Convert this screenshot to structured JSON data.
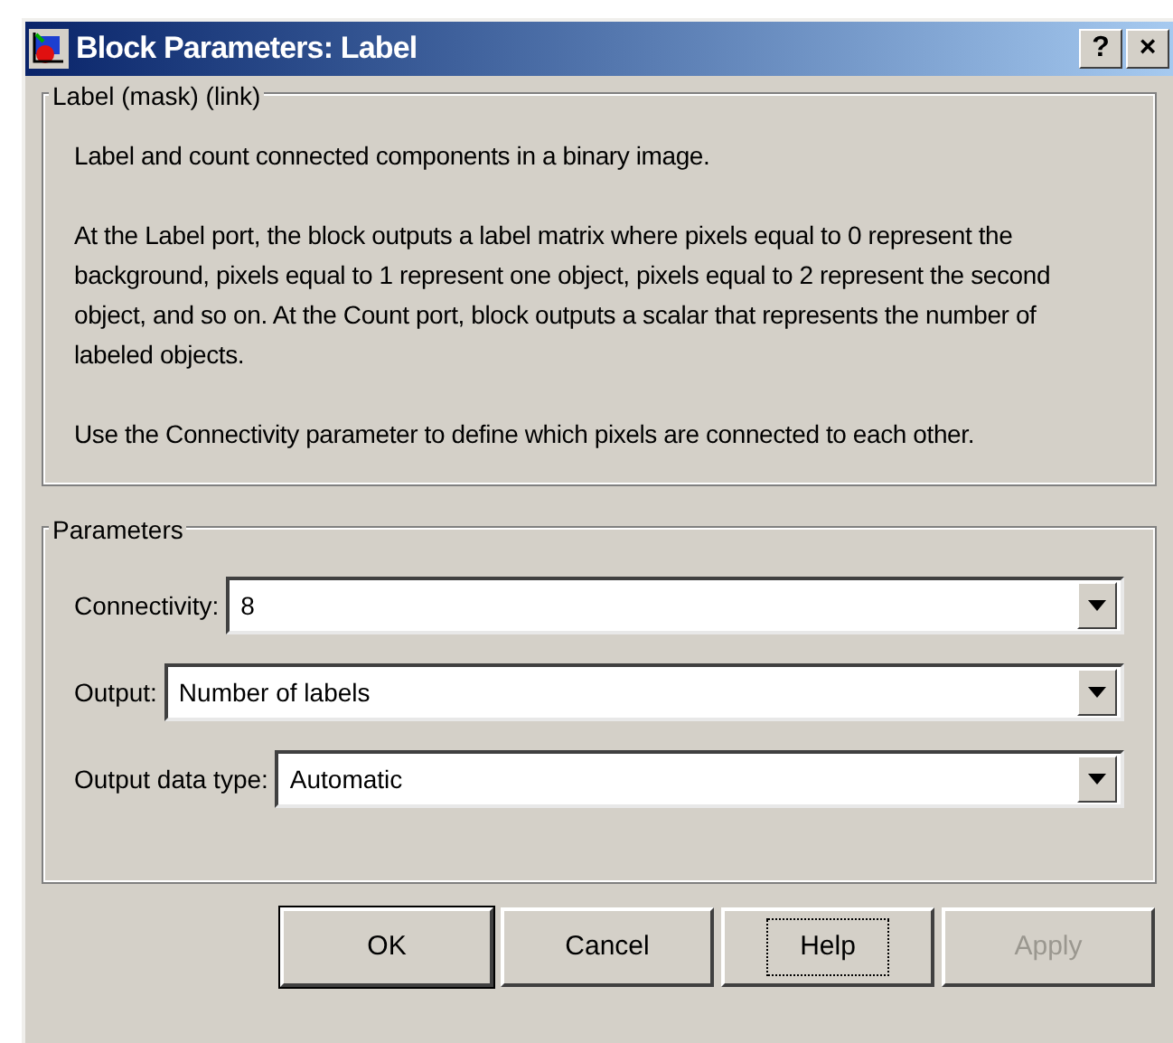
{
  "window": {
    "title": "Block Parameters: Label",
    "title_buttons": [
      "?",
      "×"
    ]
  },
  "description": {
    "legend": "Label (mask) (link)",
    "paragraphs": [
      "Label and count connected components in a binary image.",
      "At the Label port, the block outputs a label matrix where pixels equal to 0 represent the background, pixels equal to 1 represent one object, pixels equal to 2 represent the second object, and so on.  At the Count port, block outputs a scalar that represents the number of labeled objects.",
      "Use the Connectivity parameter to define which pixels are connected to each other."
    ]
  },
  "parameters": {
    "legend": "Parameters",
    "fields": [
      {
        "label": "Connectivity:",
        "value": "8"
      },
      {
        "label": "Output:",
        "value": "Number of labels"
      },
      {
        "label": "Output data type:",
        "value": "Automatic"
      }
    ]
  },
  "buttons": [
    {
      "label": "OK",
      "default": true,
      "focused": false,
      "disabled": false
    },
    {
      "label": "Cancel",
      "default": false,
      "focused": false,
      "disabled": false
    },
    {
      "label": "Help",
      "default": false,
      "focused": true,
      "disabled": false
    },
    {
      "label": "Apply",
      "default": false,
      "focused": false,
      "disabled": true
    }
  ]
}
